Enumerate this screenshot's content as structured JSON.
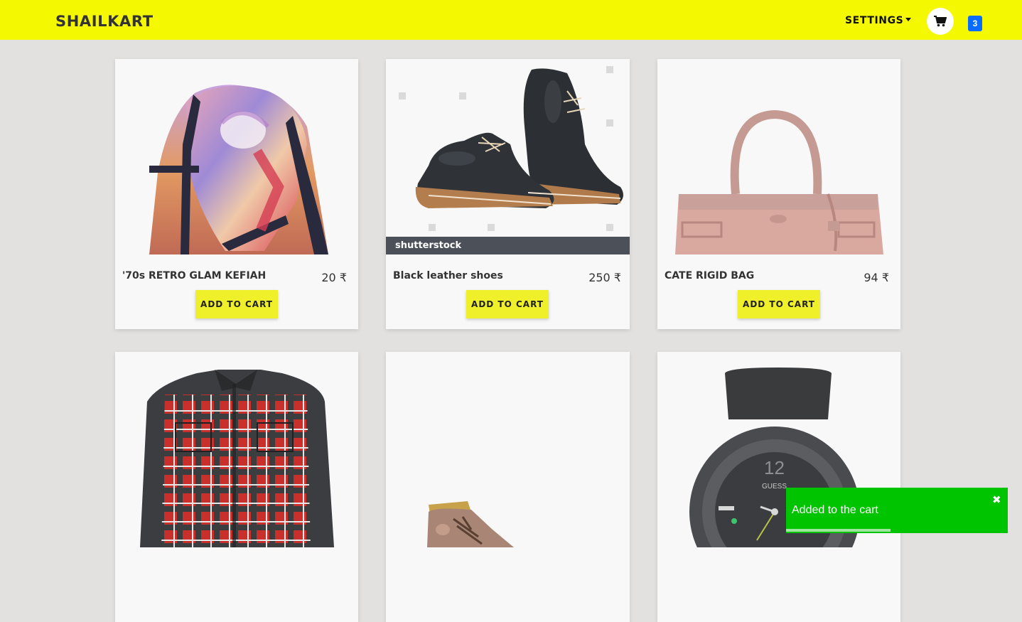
{
  "navbar": {
    "brand": "SHAILKART",
    "settings_label": "SETTINGS",
    "cart_count": "3",
    "background": "#f4f800",
    "badge_color": "#0a6cff"
  },
  "products": [
    {
      "name": "'70s RETRO GLAM KEFIAH",
      "price": "20 ₹",
      "button": "ADD TO CART",
      "image": "scarf"
    },
    {
      "name": "Black leather shoes",
      "price": "250 ₹",
      "button": "ADD TO CART",
      "image": "shoes",
      "watermark": "shutterstock"
    },
    {
      "name": "CATE RIGID BAG",
      "price": "94 ₹",
      "button": "ADD TO CART",
      "image": "bag"
    },
    {
      "image": "plaid-shirt"
    },
    {
      "image": "boot"
    },
    {
      "image": "watch",
      "watch_brand": "GUESS"
    }
  ],
  "toast": {
    "message": "Added to the cart",
    "close": "✖",
    "background": "#00c400",
    "progress": 0.47
  }
}
